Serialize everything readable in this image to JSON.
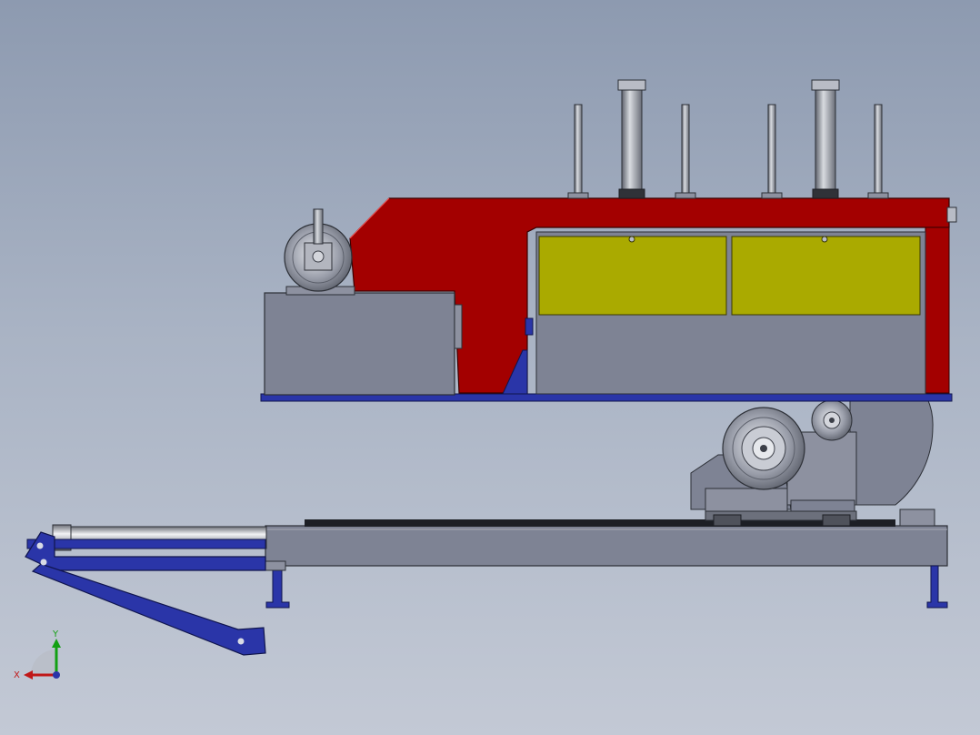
{
  "triad": {
    "x_label": "X",
    "y_label": "Y"
  },
  "colors": {
    "frame_red": "#a30000",
    "yellow_panel": "#aaaa00",
    "steel_blue": "#2a35a8",
    "gray_body": "#7e8394",
    "blade_teal": "#6fa59f",
    "background_top": "#8d9ab0",
    "background_bottom": "#c3c9d5"
  }
}
